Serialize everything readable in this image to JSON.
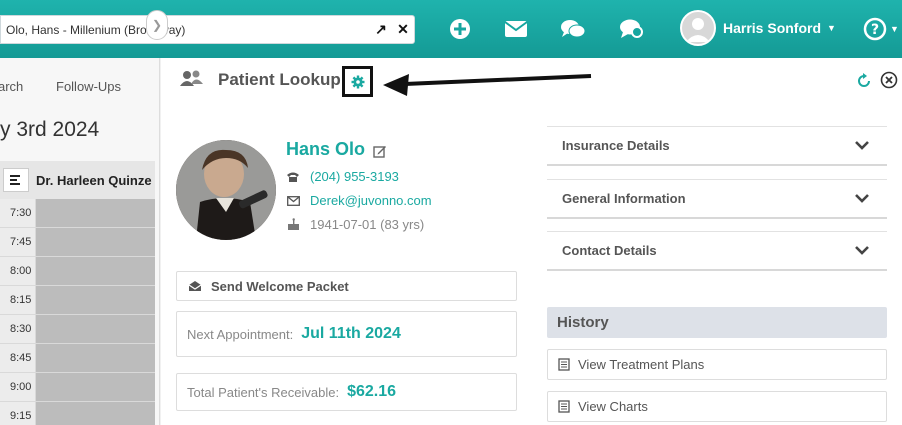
{
  "search": {
    "value": "Olo, Hans - Millenium (Broadway)"
  },
  "topbar": {
    "icons": [
      "add-icon",
      "mail-icon",
      "chat-icon",
      "feedback-icon"
    ],
    "user_name": "Harris Sonford",
    "accent": "#1aa9a1"
  },
  "left": {
    "tabs": [
      "arch",
      "Follow-Ups"
    ],
    "date_title": "y 3rd 2024",
    "doctor": "Dr. Harleen Quinze",
    "times": [
      "7:30",
      "7:45",
      "8:00",
      "8:15",
      "8:30",
      "8:45",
      "9:00",
      "9:15"
    ]
  },
  "lookup": {
    "title": "Patient Lookup",
    "patient": {
      "name": "Hans Olo",
      "phone": "(204) 955-3193",
      "email": "Derek@juvonno.com",
      "dob": "1941-07-01 (83 yrs)"
    },
    "send_welcome": "Send Welcome Packet",
    "next_appt_label": "Next Appointment:",
    "next_appt_value": "Jul 11th 2024",
    "receivable_label": "Total Patient's Receivable:",
    "receivable_value": "$62.16"
  },
  "sections": {
    "insurance": "Insurance Details",
    "general": "General Information",
    "contact": "Contact Details",
    "history": "History",
    "treatment_plans": "View Treatment Plans",
    "charts": "View Charts"
  }
}
